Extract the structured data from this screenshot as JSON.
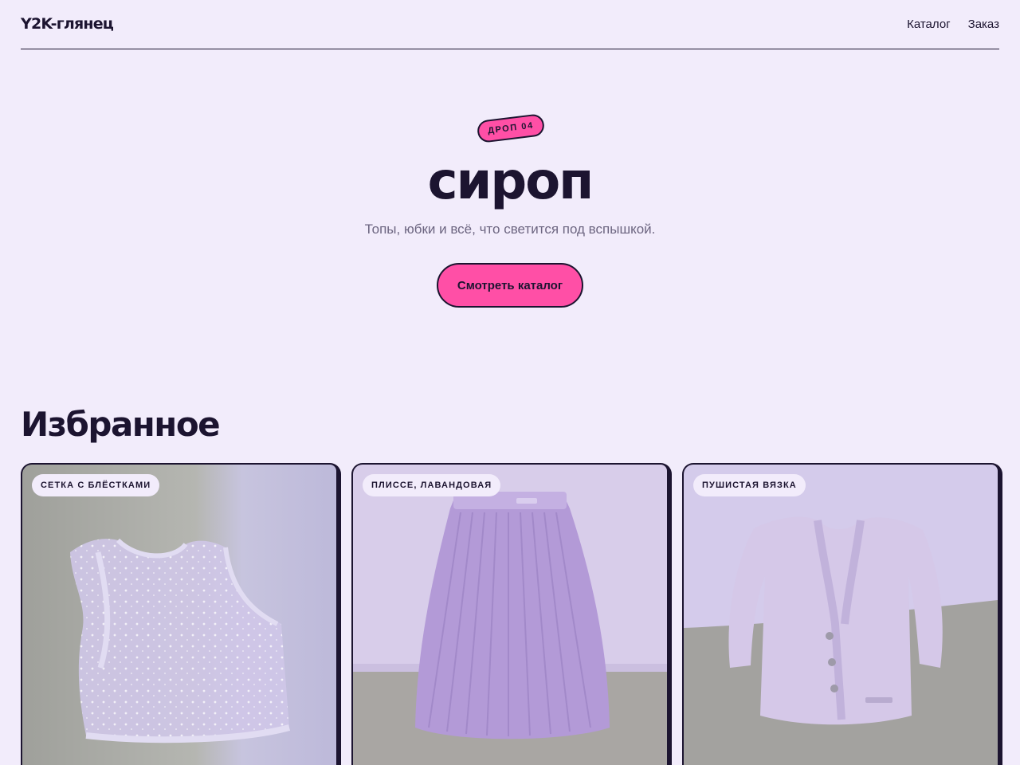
{
  "header": {
    "logo": "Y2K-глянец",
    "nav": [
      {
        "label": "Каталог"
      },
      {
        "label": "Заказ"
      }
    ]
  },
  "hero": {
    "badge": "ДРОП 04",
    "title": "сироп",
    "subtitle": "Топы, юбки и всё, что светится под вспышкой.",
    "cta_label": "Смотреть каталог"
  },
  "featured": {
    "title": "Избранное",
    "cards": [
      {
        "tag": "СЕТКА С БЛЁСТКАМИ",
        "image": "sequin-mesh-tank-top"
      },
      {
        "tag": "ПЛИССЕ, ЛАВАНДОВАЯ",
        "image": "lavender-pleated-skirt"
      },
      {
        "tag": "ПУШИСТАЯ ВЯЗКА",
        "image": "fluffy-knit-cardigan"
      }
    ]
  },
  "colors": {
    "background": "#f2ecfb",
    "ink": "#1c1430",
    "accent": "#ff4fa6",
    "muted": "#6c6580"
  }
}
